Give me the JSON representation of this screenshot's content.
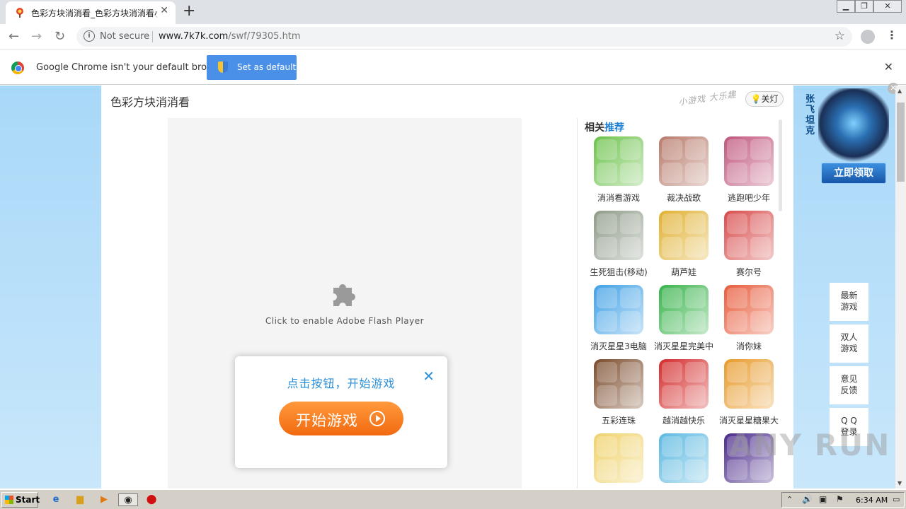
{
  "browser": {
    "tab_title": "色彩方块消消看_色彩方块消消看小游戏",
    "new_tab_symbol": "+",
    "not_secure": "Not secure",
    "url_host": "www.7k7k.com",
    "url_path": "/swf/79305.htm"
  },
  "infobar": {
    "message": "Google Chrome isn't your default browser",
    "button": "Set as default"
  },
  "page": {
    "game_title": "色彩方块消消看",
    "slogan": "小游戏 大乐趣",
    "light_toggle": "关灯",
    "flash_message": "Click to enable Adobe Flash Player",
    "popup_prompt": "点击按钮，开始游戏",
    "start_button": "开始游戏",
    "related_title_plain": "相关",
    "related_title_accent": "推荐",
    "related": [
      {
        "name": "消消看游戏",
        "color": "#6bc24a",
        "icon": "cute-blocks"
      },
      {
        "name": "裁决战歌",
        "color": "#b77a6a",
        "icon": "warrior-portrait"
      },
      {
        "name": "逃跑吧少年",
        "color": "#c0557c",
        "icon": "soldier-characters"
      },
      {
        "name": "生死狙击(移动)",
        "color": "#8e9a88",
        "icon": "sniper-scene"
      },
      {
        "name": "葫芦娃",
        "color": "#e0b030",
        "icon": "cartoon-hero"
      },
      {
        "name": "赛尔号",
        "color": "#d84a4a",
        "icon": "robot-hero"
      },
      {
        "name": "消灭星星3电脑",
        "color": "#3ea0e6",
        "icon": "stars-grid"
      },
      {
        "name": "消灭星星完美中",
        "color": "#37b34a",
        "icon": "stars-grid"
      },
      {
        "name": "消你妹",
        "color": "#e85a3a",
        "icon": "fruit-grid"
      },
      {
        "name": "五彩连珠",
        "color": "#7a4a2a",
        "icon": "balls-grid"
      },
      {
        "name": "越消越快乐",
        "color": "#d42a2a",
        "icon": "color-blocks"
      },
      {
        "name": "消灭星星糖果大",
        "color": "#e89a2a",
        "icon": "candy-grid"
      },
      {
        "name": "",
        "color": "#f0d26a",
        "icon": "fruit-faces"
      },
      {
        "name": "",
        "color": "#5ab8e0",
        "icon": "candy-pieces"
      },
      {
        "name": "",
        "color": "#4a2a8a",
        "icon": "gem-blocks"
      }
    ],
    "ad_vertical_text": "张飞坦克",
    "ad_claim": "立即领取",
    "side_menu": [
      {
        "line1": "最新",
        "line2": "游戏"
      },
      {
        "line1": "双人",
        "line2": "游戏"
      },
      {
        "line1": "意见",
        "line2": "反馈"
      },
      {
        "line1": "Q Q",
        "line2": "登录"
      }
    ]
  },
  "taskbar": {
    "start": "Start",
    "clock": "6:34 AM"
  },
  "watermark": "ANY RUN"
}
